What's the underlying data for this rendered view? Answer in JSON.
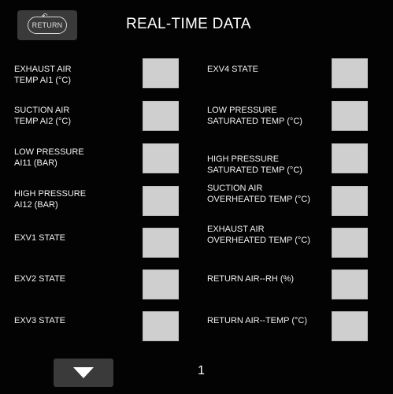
{
  "header": {
    "return_label": "RETURN",
    "title": "REAL-TIME DATA"
  },
  "left_params": [
    {
      "line1": "EXHAUST AIR",
      "line2": "TEMP AI1 (°C)"
    },
    {
      "line1": "SUCTION AIR",
      "line2": "TEMP AI2 (°C)"
    },
    {
      "line1": "LOW PRESSURE",
      "line2": "AI11 (bar)"
    },
    {
      "line1": "HIGH PRESSURE",
      "line2": "AI12 (bar)"
    },
    {
      "line1": "EXV1 STATE",
      "line2": ""
    },
    {
      "line1": "EXV2 STATE",
      "line2": ""
    },
    {
      "line1": "EXV3 STATE",
      "line2": ""
    }
  ],
  "right_params": [
    {
      "line1": "EXV4 STATE",
      "line2": ""
    },
    {
      "line1": "LOW PRESSURE",
      "line2": "SATURATED TEMP (°C)"
    },
    {
      "line1": "HIGH PRESSURE",
      "line2": "SATURATED TEMP (°C)"
    },
    {
      "line1": "SUCTION AIR",
      "line2": "OVERHEATED TEMP (°C)"
    },
    {
      "line1": "EXHAUST AIR",
      "line2": "OVERHEATED TEMP (°C)"
    },
    {
      "line1": "RETURN AIR--RH (%)",
      "line2": ""
    },
    {
      "line1": "RETURN AIR--TEMP (°C)",
      "line2": ""
    }
  ],
  "footer": {
    "page_number": "1"
  },
  "colors": {
    "background": "#030303",
    "button": "#3a3a3a",
    "value_box": "#cfcfcf"
  }
}
